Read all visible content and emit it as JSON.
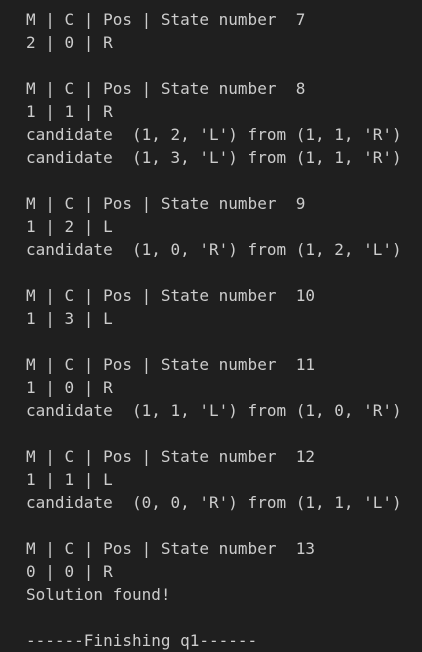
{
  "lines": [
    "M | C | Pos | State number  7",
    "2 | 0 | R",
    "",
    "M | C | Pos | State number  8",
    "1 | 1 | R",
    "candidate  (1, 2, 'L') from (1, 1, 'R')",
    "candidate  (1, 3, 'L') from (1, 1, 'R')",
    "",
    "M | C | Pos | State number  9",
    "1 | 2 | L",
    "candidate  (1, 0, 'R') from (1, 2, 'L')",
    "",
    "M | C | Pos | State number  10",
    "1 | 3 | L",
    "",
    "M | C | Pos | State number  11",
    "1 | 0 | R",
    "candidate  (1, 1, 'L') from (1, 0, 'R')",
    "",
    "M | C | Pos | State number  12",
    "1 | 1 | L",
    "candidate  (0, 0, 'R') from (1, 1, 'L')",
    "",
    "M | C | Pos | State number  13",
    "0 | 0 | R",
    "Solution found!",
    "",
    "------Finishing q1------"
  ]
}
